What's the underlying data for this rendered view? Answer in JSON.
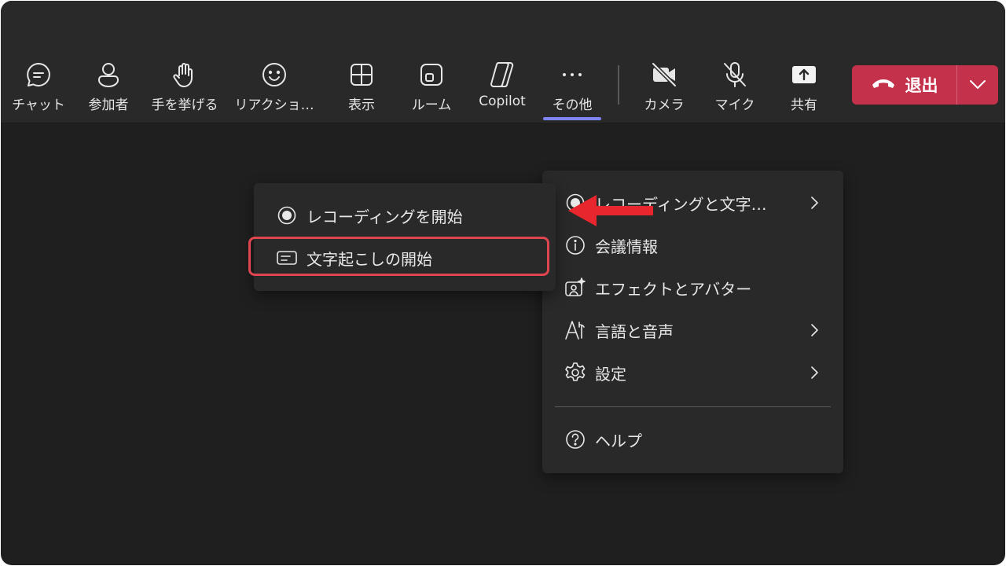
{
  "toolbar": {
    "items": [
      {
        "label": "チャット",
        "icon": "chat-icon"
      },
      {
        "label": "参加者",
        "icon": "people-icon"
      },
      {
        "label": "手を挙げる",
        "icon": "raise-hand-icon"
      },
      {
        "label": "リアクショ…",
        "icon": "smiley-icon"
      },
      {
        "label": "表示",
        "icon": "grid-view-icon"
      },
      {
        "label": "ルーム",
        "icon": "breakout-room-icon"
      },
      {
        "label": "Copilot",
        "icon": "copilot-icon"
      },
      {
        "label": "その他",
        "icon": "more-icon"
      },
      {
        "label": "カメラ",
        "icon": "camera-off-icon"
      },
      {
        "label": "マイク",
        "icon": "mic-off-icon"
      },
      {
        "label": "共有",
        "icon": "share-icon"
      }
    ],
    "leave_label": "退出"
  },
  "more_menu": {
    "items": [
      {
        "label": "レコーディングと文字…",
        "icon": "record-icon",
        "submenu": true
      },
      {
        "label": "会議情報",
        "icon": "info-icon",
        "submenu": false
      },
      {
        "label": "エフェクトとアバター",
        "icon": "effects-icon",
        "submenu": false
      },
      {
        "label": "言語と音声",
        "icon": "language-icon",
        "submenu": true
      },
      {
        "label": "設定",
        "icon": "gear-icon",
        "submenu": true
      },
      {
        "label": "ヘルプ",
        "icon": "help-icon",
        "submenu": false
      }
    ]
  },
  "recording_submenu": {
    "items": [
      {
        "label": "レコーディングを開始",
        "icon": "record-icon"
      },
      {
        "label": "文字起こしの開始",
        "icon": "transcript-icon"
      }
    ]
  },
  "colors": {
    "accent": "#7f85f5",
    "leave": "#c4314b",
    "highlight": "#e0464f",
    "arrow": "#e8262d"
  }
}
